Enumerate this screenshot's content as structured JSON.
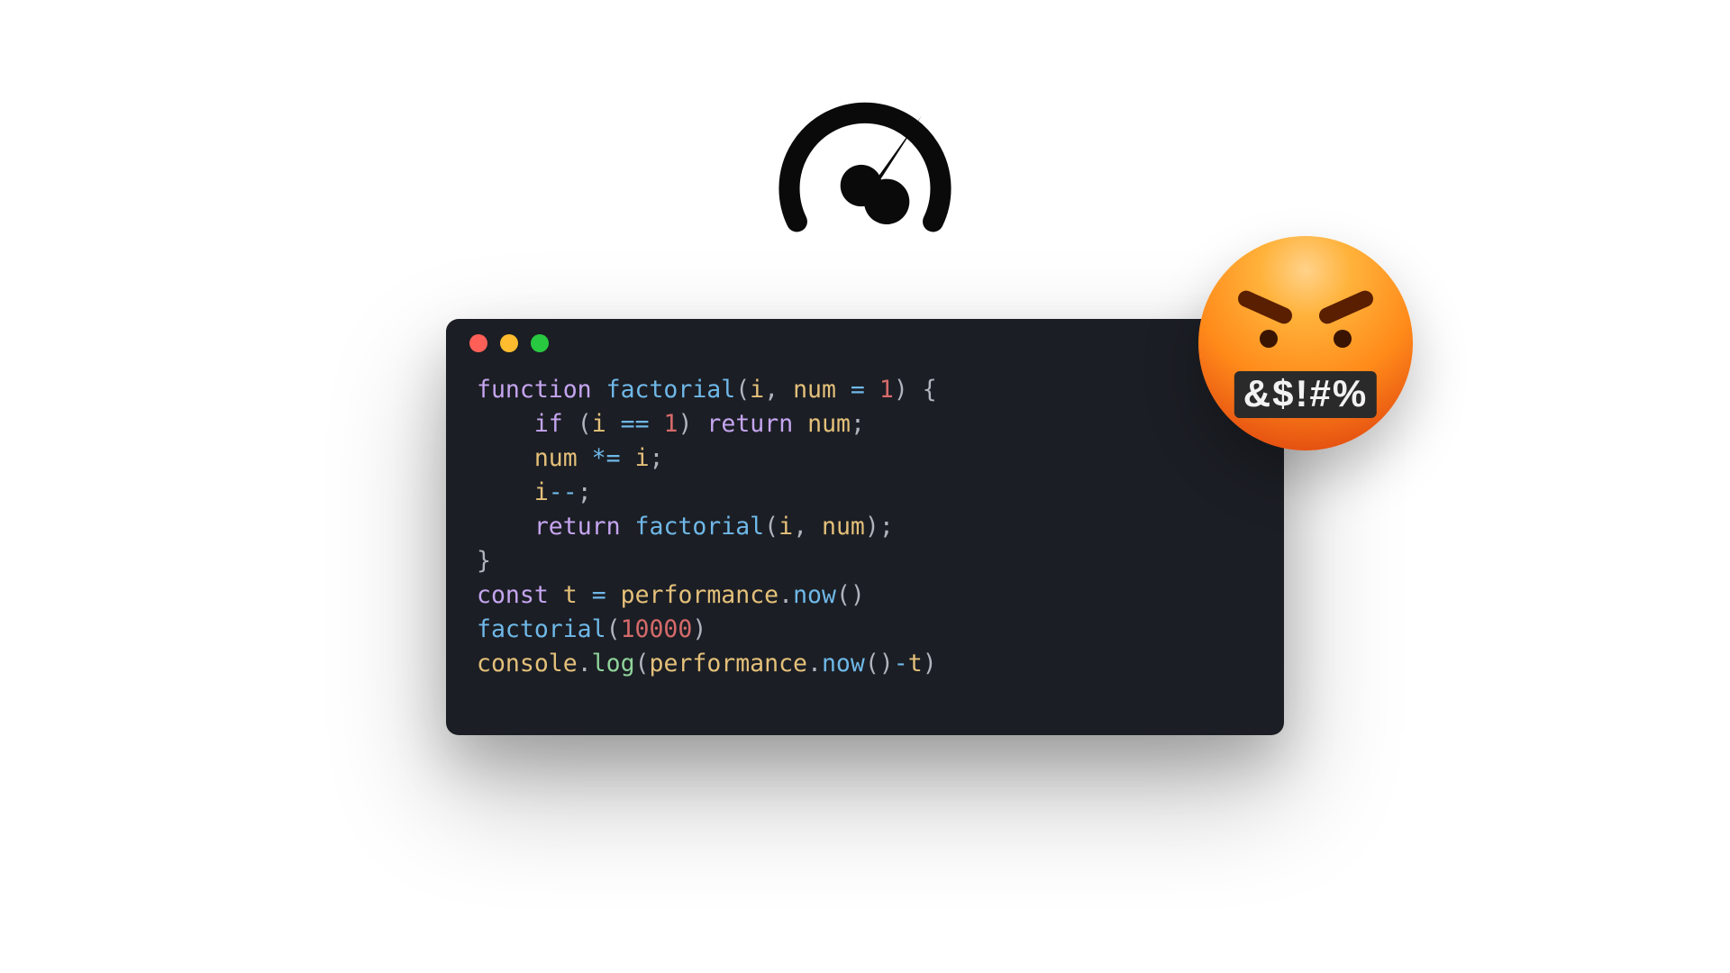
{
  "gauge": {
    "name": "speed-gauge-icon"
  },
  "window": {
    "traffic_lights": [
      "close",
      "minimize",
      "zoom"
    ]
  },
  "code": {
    "l1": {
      "kw_function": "function",
      "fn": "factorial",
      "p1": "i",
      "p2": "num",
      "eq": "=",
      "one": "1"
    },
    "l2": {
      "kw_if": "if",
      "i": "i",
      "eqeq": "==",
      "one": "1",
      "kw_return": "return",
      "num": "num"
    },
    "l3": {
      "num": "num",
      "op": "*=",
      "i": "i"
    },
    "l4": {
      "i": "i",
      "op": "--"
    },
    "l5": {
      "kw_return": "return",
      "fn": "factorial",
      "i": "i",
      "num": "num"
    },
    "l7": {
      "kw_const": "const",
      "t": "t",
      "perf": "performance",
      "now": "now"
    },
    "l8": {
      "fn": "factorial",
      "arg": "10000"
    },
    "l9": {
      "console": "console",
      "log": "log",
      "perf": "performance",
      "now": "now",
      "t": "t"
    }
  },
  "emoji": {
    "swear_text": "&$!#%"
  }
}
